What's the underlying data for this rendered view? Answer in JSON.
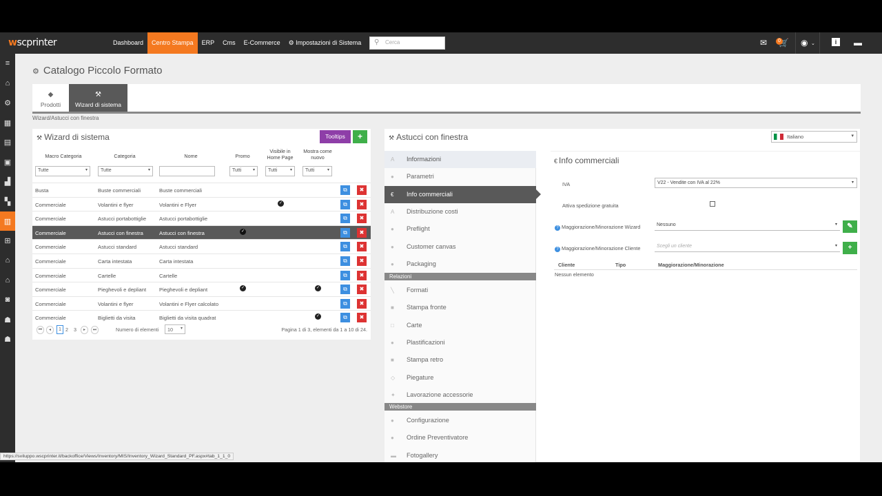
{
  "app": {
    "logo_prefix": "w",
    "logo_text": "scprinter"
  },
  "nav": [
    "Dashboard",
    "Centro Stampa",
    "ERP",
    "Cms",
    "E-Commerce",
    "⚙ Impostazioni di Sistema"
  ],
  "search": {
    "placeholder": "Cerca"
  },
  "cart_badge": "0",
  "page": {
    "title": "Catalogo Piccolo Formato"
  },
  "tabs": [
    {
      "label": "Prodotti"
    },
    {
      "label": "Wizard di sistema"
    }
  ],
  "breadcrumb": "Wizard/Astucci con finestra",
  "wizard": {
    "title": "Wizard di sistema",
    "tooltips_label": "Tooltips",
    "add_label": "+",
    "columns": [
      "Macro Categoria",
      "Categoria",
      "Nome",
      "Promo",
      "Visibile in Home Page",
      "Mostra come nuovo"
    ],
    "filters": {
      "macro": "Tutte",
      "categoria": "Tutte",
      "promo": "Tutti",
      "homepage": "Tutti",
      "nuovo": "Tutti"
    },
    "rows": [
      {
        "macro": "Busta",
        "categoria": "Buste commerciali",
        "nome": "Buste commerciali",
        "promo": false,
        "home": false,
        "nuovo": false
      },
      {
        "macro": "Commerciale",
        "categoria": "Volantini e flyer",
        "nome": "Volantini e Flyer",
        "promo": false,
        "home": true,
        "nuovo": false
      },
      {
        "macro": "Commerciale",
        "categoria": "Astucci portabottiglie",
        "nome": "Astucci portabottiglie",
        "promo": false,
        "home": false,
        "nuovo": false
      },
      {
        "macro": "Commerciale",
        "categoria": "Astucci con finestra",
        "nome": "Astucci con finestra",
        "promo": true,
        "home": false,
        "nuovo": false,
        "selected": true
      },
      {
        "macro": "Commerciale",
        "categoria": "Astucci standard",
        "nome": "Astucci standard",
        "promo": false,
        "home": false,
        "nuovo": false
      },
      {
        "macro": "Commerciale",
        "categoria": "Carta intestata",
        "nome": "Carta intestata",
        "promo": false,
        "home": false,
        "nuovo": false
      },
      {
        "macro": "Commerciale",
        "categoria": "Cartelle",
        "nome": "Cartelle",
        "promo": false,
        "home": false,
        "nuovo": false
      },
      {
        "macro": "Commerciale",
        "categoria": "Pieghevoli e depliant",
        "nome": "Pieghevoli e depliant",
        "promo": true,
        "home": false,
        "nuovo": true
      },
      {
        "macro": "Commerciale",
        "categoria": "Volantini e flyer",
        "nome": "Volantini e Flyer calcolato",
        "promo": false,
        "home": false,
        "nuovo": false
      },
      {
        "macro": "Commerciale",
        "categoria": "Biglietti da visita",
        "nome": "Biglietti da visita quadrat",
        "promo": false,
        "home": false,
        "nuovo": true
      }
    ],
    "pager": {
      "pages": [
        "1",
        "2",
        "3"
      ],
      "current": "1",
      "items_label": "Numero di elementi",
      "page_size": "10",
      "summary": "Pagina 1 di 3, elementi da 1 a 10 di 24."
    }
  },
  "detail": {
    "title": "Astucci con finestra",
    "language": "Italiano",
    "menu": [
      {
        "label": "Informazioni",
        "icon": "A",
        "state": "hover"
      },
      {
        "label": "Parametri",
        "icon": "●"
      },
      {
        "label": "Info commerciali",
        "icon": "€",
        "state": "active"
      },
      {
        "label": "Distribuzione costi",
        "icon": "A"
      },
      {
        "label": "Preflight",
        "icon": "●"
      },
      {
        "label": "Customer canvas",
        "icon": "●"
      },
      {
        "label": "Packaging",
        "icon": "●"
      }
    ],
    "section_relazioni": "Relazioni",
    "relazioni": [
      {
        "label": "Formati",
        "icon": "╲"
      },
      {
        "label": "Stampa fronte",
        "icon": "■"
      },
      {
        "label": "Carte",
        "icon": "□"
      },
      {
        "label": "Plastificazioni",
        "icon": "●"
      },
      {
        "label": "Stampa retro",
        "icon": "■"
      },
      {
        "label": "Piegature",
        "icon": "◇"
      },
      {
        "label": "Lavorazione accessorie",
        "icon": "✦"
      }
    ],
    "section_webstore": "Webstore",
    "webstore": [
      {
        "label": "Configurazione",
        "icon": "●"
      },
      {
        "label": "Ordine Preventivatore",
        "icon": "●"
      },
      {
        "label": "Fotogallery",
        "icon": "▬"
      }
    ]
  },
  "info": {
    "title": "Info commerciali",
    "iva_label": "IVA",
    "iva_value": "V22 - Vendite con IVA al 22%",
    "spedizione_label": "Attiva spedizione gratuita",
    "wizard_label": "Maggiorazione/Minorazione Wizard",
    "wizard_value": "Nessuno",
    "cliente_label": "Maggiorazione/Minorazione Cliente",
    "cliente_placeholder": "Scegli un cliente",
    "table_headers": [
      "Cliente",
      "Tipo",
      "Maggiorazione/Minorazione"
    ],
    "empty": "Nessun elemento"
  },
  "status_url": "https://sviluppo.wscprinter.it/backoffice/Views/Inventory/MIS/Inventory_Wizard_Standard_PF.aspx#tab_1_1_0"
}
